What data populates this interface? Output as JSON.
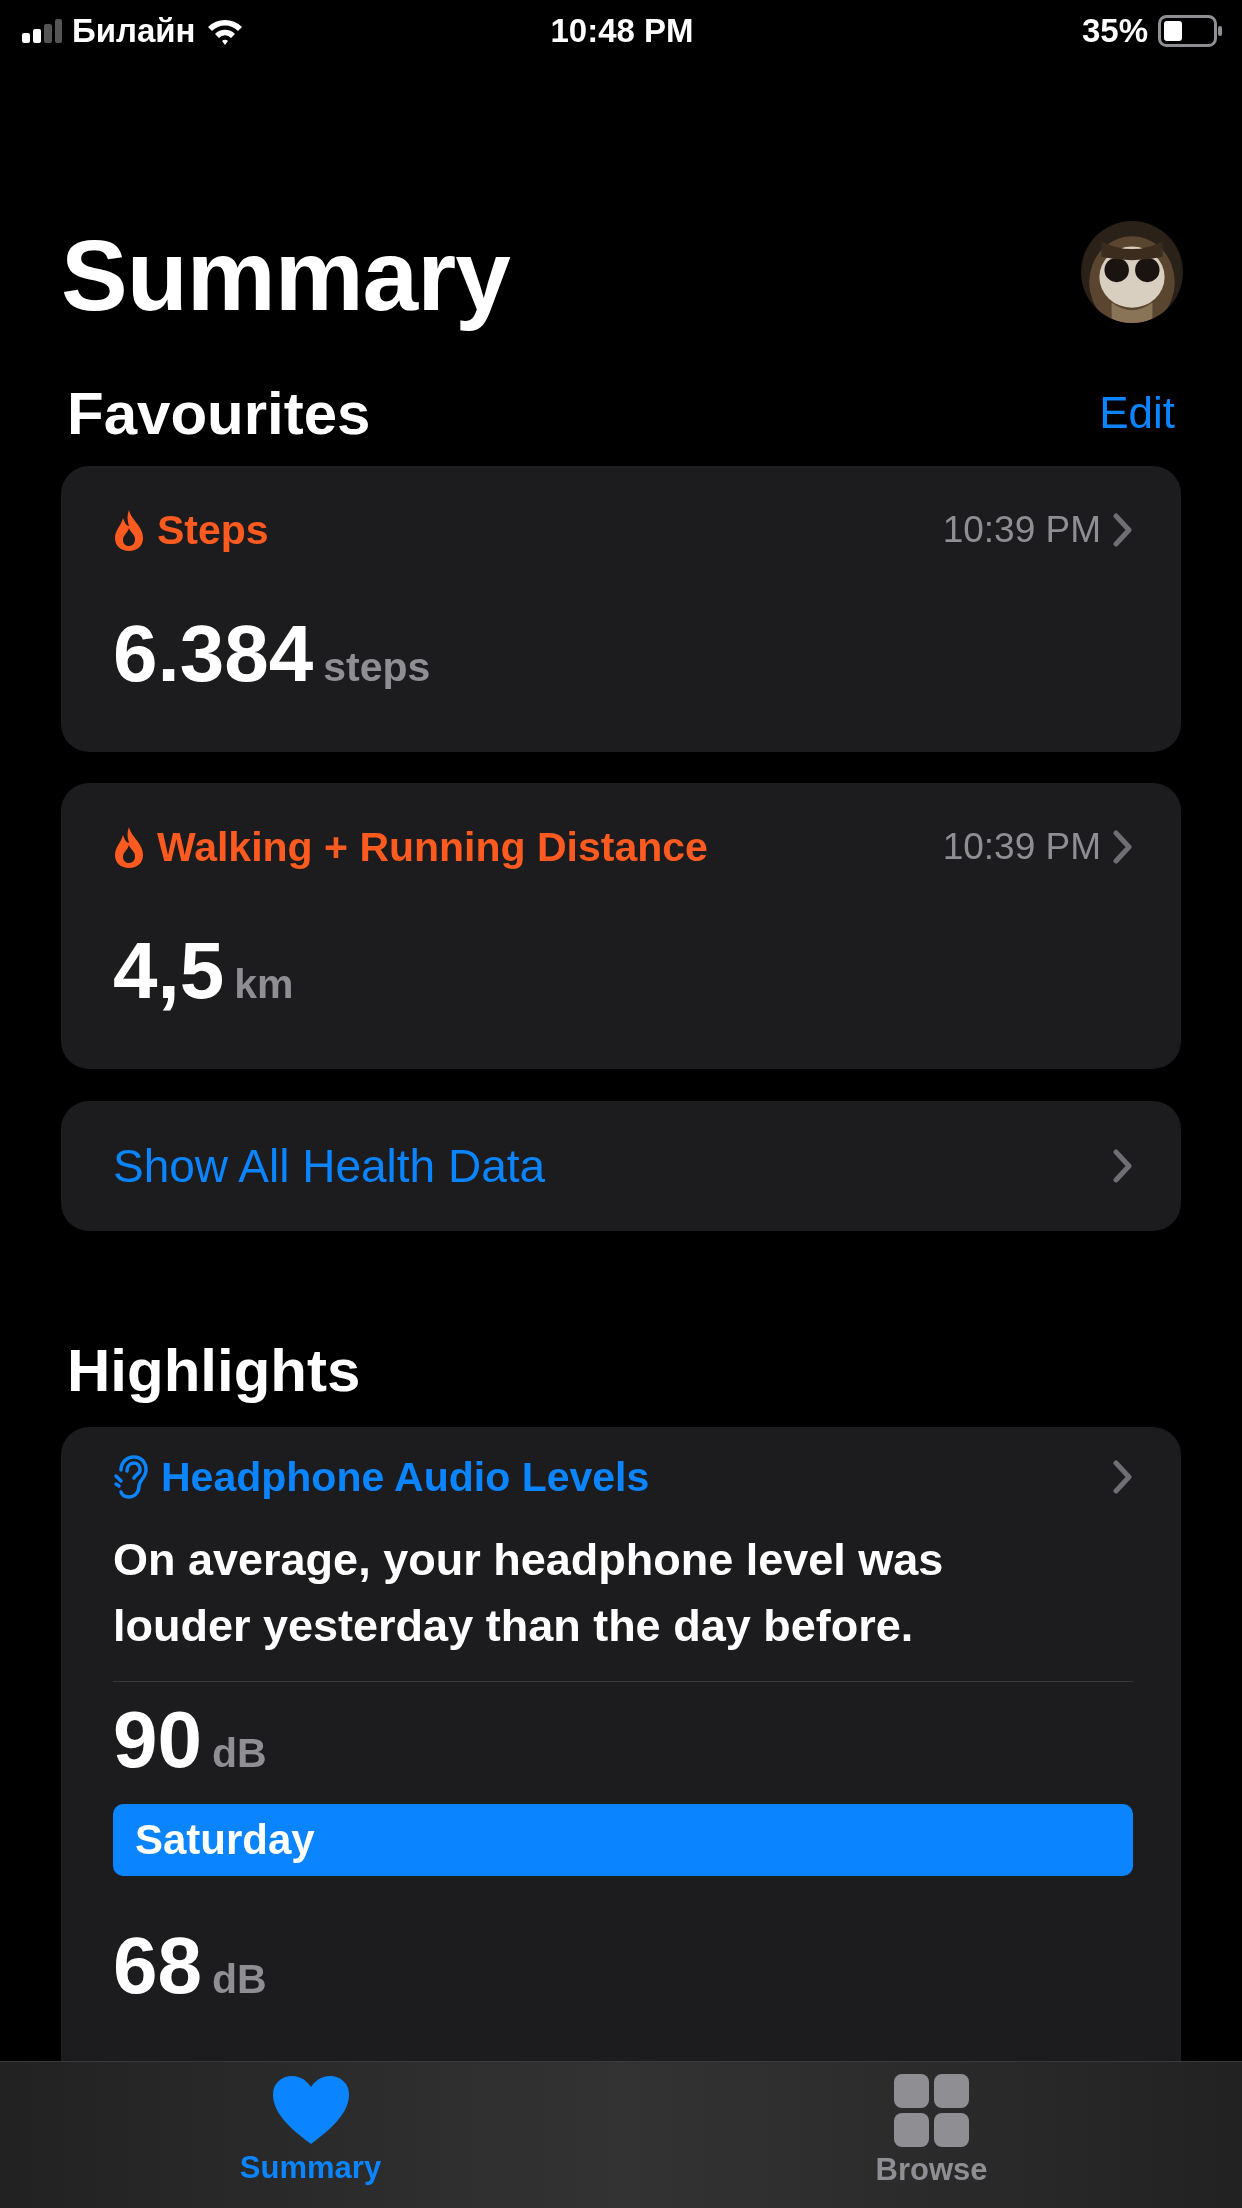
{
  "status_bar": {
    "carrier": "Билайн",
    "time": "10:48 PM",
    "battery": "35%"
  },
  "title": "Summary",
  "favourites": {
    "heading": "Favourites",
    "edit": "Edit",
    "cards": [
      {
        "title": "Steps",
        "time": "10:39 PM",
        "value": "6.384",
        "unit": "steps"
      },
      {
        "title": "Walking + Running Distance",
        "time": "10:39 PM",
        "value": "4,5",
        "unit": "km"
      }
    ],
    "show_all": "Show All Health Data"
  },
  "highlights": {
    "heading": "Highlights",
    "title": "Headphone Audio Levels",
    "text": "On average, your headphone level was louder yesterday than the day before.",
    "bars": [
      {
        "value": "90",
        "unit": "dB",
        "label": "Saturday"
      },
      {
        "value": "68",
        "unit": "dB"
      }
    ]
  },
  "tab_bar": [
    {
      "label": "Summary",
      "kind": "heart",
      "selected": true
    },
    {
      "label": "Browse",
      "kind": "grid",
      "selected": false
    }
  ]
}
